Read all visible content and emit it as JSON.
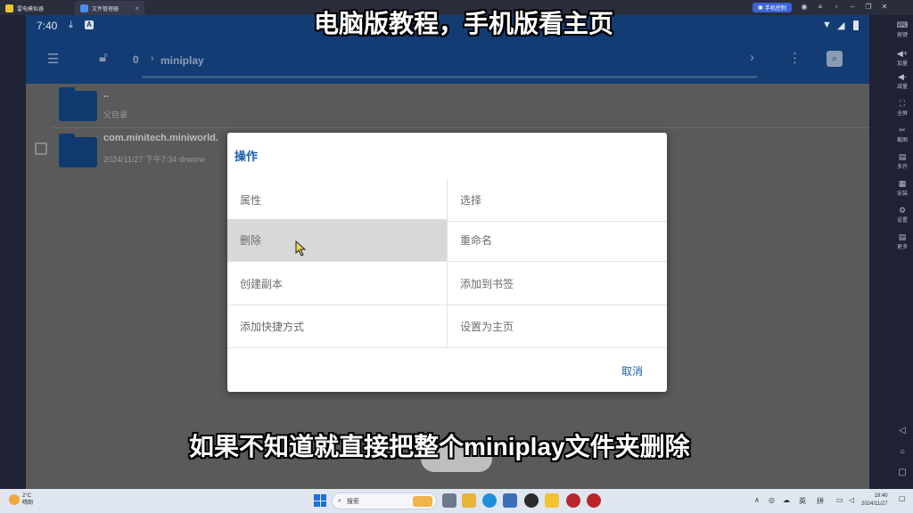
{
  "emulator": {
    "tabs": [
      {
        "label": "雷电模拟器"
      },
      {
        "label": "文件管理器"
      }
    ],
    "phone_control": "手机控制",
    "right_toolbar": [
      {
        "label": "按键",
        "icon": "keyboard-icon"
      },
      {
        "label": "加量",
        "icon": "volume-up-icon"
      },
      {
        "label": "减量",
        "icon": "volume-down-icon"
      },
      {
        "label": "全屏",
        "icon": "fullscreen-icon"
      },
      {
        "label": "截图",
        "icon": "scissors-icon"
      },
      {
        "label": "多开",
        "icon": "multi-instance-icon"
      },
      {
        "label": "安装",
        "icon": "install-icon"
      },
      {
        "label": "设置",
        "icon": "gear-icon"
      },
      {
        "label": "更多",
        "icon": "more-icon"
      }
    ]
  },
  "android": {
    "status_time": "7:40",
    "appbar": {
      "count": "0",
      "path": "miniplay"
    },
    "files": [
      {
        "name": "..",
        "sub": "父目录"
      },
      {
        "name": "com.minitech.miniworld.",
        "sub": "2024/11/27 下午7:34  drwxrw"
      }
    ]
  },
  "dialog": {
    "title": "操作",
    "options": [
      [
        "属性",
        "选择"
      ],
      [
        "删除",
        "重命名"
      ],
      [
        "创建副本",
        "添加到书签"
      ],
      [
        "添加快捷方式",
        "设置为主页"
      ]
    ],
    "cancel": "取消"
  },
  "captions": {
    "top": "电脑版教程，手机版看主页",
    "bottom": "如果不知道就直接把整个miniplay文件夹删除"
  },
  "taskbar": {
    "weather_temp": "2°C",
    "weather_desc": "晴朗",
    "search": "搜索",
    "ime_lang": "英",
    "ime_mode": "拼",
    "time": "19:40",
    "date": "2024/11/27"
  },
  "colors": {
    "appbar": "#123c73",
    "accent": "#1b5fab",
    "selected_row": "#d8d8d8"
  }
}
